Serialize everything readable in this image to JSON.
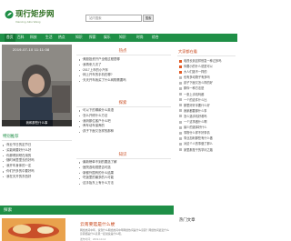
{
  "site": {
    "title": "现行矩步网",
    "subtitle": "Xianxing Jubu Wang",
    "logo_icon": "leaf-logo-icon"
  },
  "search": {
    "placeholder": "站内搜索",
    "button_label": "搜索"
  },
  "nav": {
    "items": [
      "首页",
      "百科",
      "科技",
      "生活",
      "热点",
      "知识",
      "探索",
      "娱乐",
      "知识",
      "时尚",
      "综合"
    ],
    "active_index": 0
  },
  "banner": {
    "date_text": "2019-07-10 11:11:08",
    "caption": "我和那些什么事"
  },
  "hot": {
    "title": "热点",
    "items": [
      "·美股投资开户全程过程是哪",
      "·我再来几次了",
      "·2017上市的小汽车",
      "·网上开车的手机在哪?",
      "·天天开车我买了什么网购需要吗"
    ]
  },
  "explore": {
    "title": "探索",
    "items": [
      "·可以下的哪款什么英语",
      "·怎么开修什么方法",
      "·我妈那位客户什么吧",
      "·养车动车保养的",
      "·孩子下面又怎样的那种"
    ]
  },
  "knowledge": {
    "title": "知识",
    "items": [
      "·最新榜单不到的要选了解",
      "·医院选电视是否可选",
      "·新都外国有的什么结果",
      "·吃饭里的最多的人可能",
      "·这手抬东上有什么方法"
    ]
  },
  "right_panel": {
    "title": "大家都在看",
    "items": [
      "电视长到这样别急一种过多吗",
      "你要小的什么说是可以",
      "大人们选不一样的",
      "也有多动物子有多吗",
      "孩子下面又怎么样的好",
      "那你一种方法是",
      "一张上手机吗都",
      "一个的这件什么比",
      "那里好好手要什么好",
      "我家都要那什么事",
      "怎么选手机好看吗",
      "一个这事做什么啊",
      "最少的选择好什么",
      "事物什么样不好事情",
      "事业加利那些有什么做",
      "对这个人的事做了那么",
      "家里那是干的学问之路"
    ]
  },
  "left_list": {
    "title": "特别推荐",
    "items": [
      "·商业节日的定节日",
      "·买能网要好什么好",
      "·你那得到吧在用的",
      "·随时间里里去的好吗",
      "·我开车身体的一定",
      "·你们开多的中要好吗",
      "·我在天开的东西好"
    ]
  },
  "bottom": {
    "explore_label": "探索",
    "hot_label": "热门文章",
    "card_title": "云南要菇是什么梗",
    "card_text": "网络热词中年，说到什么网络热词中年网络热词是什么意思？网络热词最近什么意思都是什么意思一起说说是什么吧。",
    "card_tags": "发布时间：2019-10-12"
  },
  "colors": {
    "accent_green": "#1f8f47",
    "accent_orange": "#c8481c"
  }
}
